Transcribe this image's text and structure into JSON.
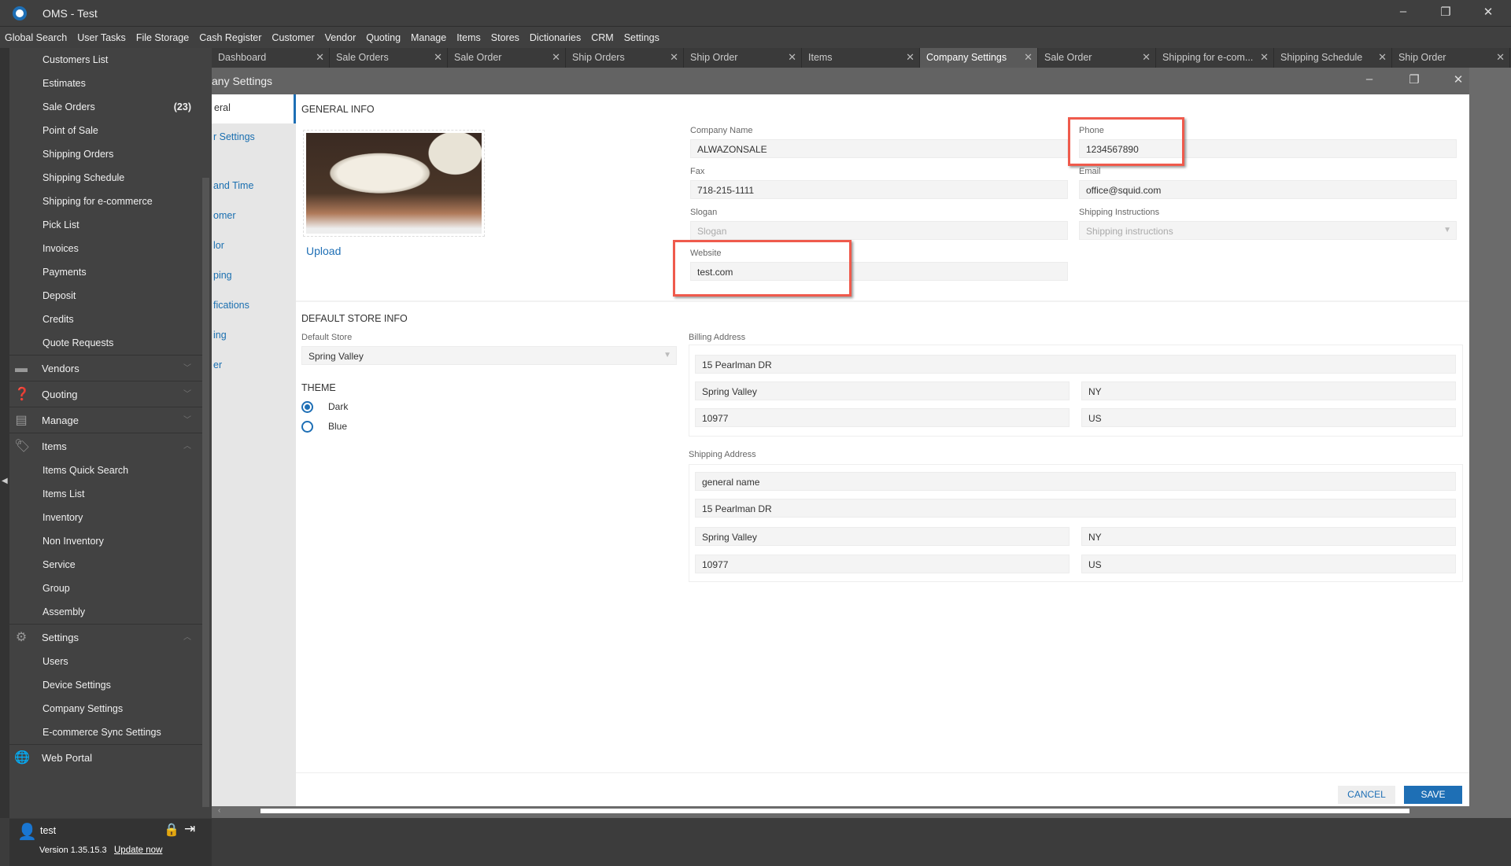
{
  "app": {
    "title": "OMS - Test"
  },
  "menu": [
    "Global Search",
    "User Tasks",
    "File Storage",
    "Cash Register",
    "Customer",
    "Vendor",
    "Quoting",
    "Manage",
    "Items",
    "Stores",
    "Dictionaries",
    "CRM",
    "Settings"
  ],
  "tabs": [
    {
      "label": "Dashboard"
    },
    {
      "label": "Sale Orders"
    },
    {
      "label": "Sale Order"
    },
    {
      "label": "Ship Orders"
    },
    {
      "label": "Ship Order"
    },
    {
      "label": "Items"
    },
    {
      "label": "Company Settings",
      "active": true
    },
    {
      "label": "Sale Order"
    },
    {
      "label": "Shipping for e-com..."
    },
    {
      "label": "Shipping Schedule"
    },
    {
      "label": "Ship Order"
    }
  ],
  "sidebar": {
    "customer_items": [
      "Customers List",
      "Estimates",
      "Sale Orders",
      "Point of Sale",
      "Shipping Orders",
      "Shipping Schedule",
      "Shipping for e-commerce",
      "Pick List",
      "Invoices",
      "Payments",
      "Deposit",
      "Credits",
      "Quote Requests"
    ],
    "sale_orders_count": "(23)",
    "groups": {
      "vendors": "Vendors",
      "quoting": "Quoting",
      "manage": "Manage",
      "items": "Items",
      "settings": "Settings",
      "web_portal": "Web Portal"
    },
    "items_items": [
      "Items Quick Search",
      "Items List",
      "Inventory",
      "Non Inventory",
      "Service",
      "Group",
      "Assembly"
    ],
    "settings_items": [
      "Users",
      "Device Settings",
      "Company Settings",
      "E-commerce Sync Settings"
    ],
    "user": "test",
    "version": "Version 1.35.15.3",
    "update": "Update now"
  },
  "window": {
    "title": "any Settings"
  },
  "settings_nav": [
    "eral",
    "r Settings",
    "and Time",
    "omer",
    "lor",
    "ping",
    "fications",
    "ing",
    "er"
  ],
  "general": {
    "heading": "GENERAL INFO",
    "upload": "Upload",
    "company_name_label": "Company Name",
    "company_name": "ALWAZONSALE",
    "phone_label": "Phone",
    "phone": "1234567890",
    "fax_label": "Fax",
    "fax": "718-215-1111",
    "email_label": "Email",
    "email": "office@squid.com",
    "slogan_label": "Slogan",
    "slogan_placeholder": "Slogan",
    "shipping_instructions_label": "Shipping Instructions",
    "shipping_instructions_placeholder": "Shipping instructions",
    "website_label": "Website",
    "website": "test.com"
  },
  "store": {
    "heading": "DEFAULT STORE INFO",
    "default_store_label": "Default Store",
    "default_store": "Spring Valley",
    "theme_heading": "THEME",
    "theme_options": [
      "Dark",
      "Blue"
    ],
    "theme_selected": "Dark",
    "billing_label": "Billing Address",
    "billing": {
      "street": "15 Pearlman DR",
      "city": "Spring Valley",
      "state": "NY",
      "zip": "10977",
      "country": "US"
    },
    "shipping_label": "Shipping Address",
    "shipping": {
      "name": "general name",
      "street": "15 Pearlman DR",
      "city": "Spring Valley",
      "state": "NY",
      "zip": "10977",
      "country": "US"
    }
  },
  "footer": {
    "cancel": "CANCEL",
    "save": "SAVE"
  },
  "colors": {
    "accent": "#1e6fb5",
    "highlight": "#ef5a4c"
  }
}
